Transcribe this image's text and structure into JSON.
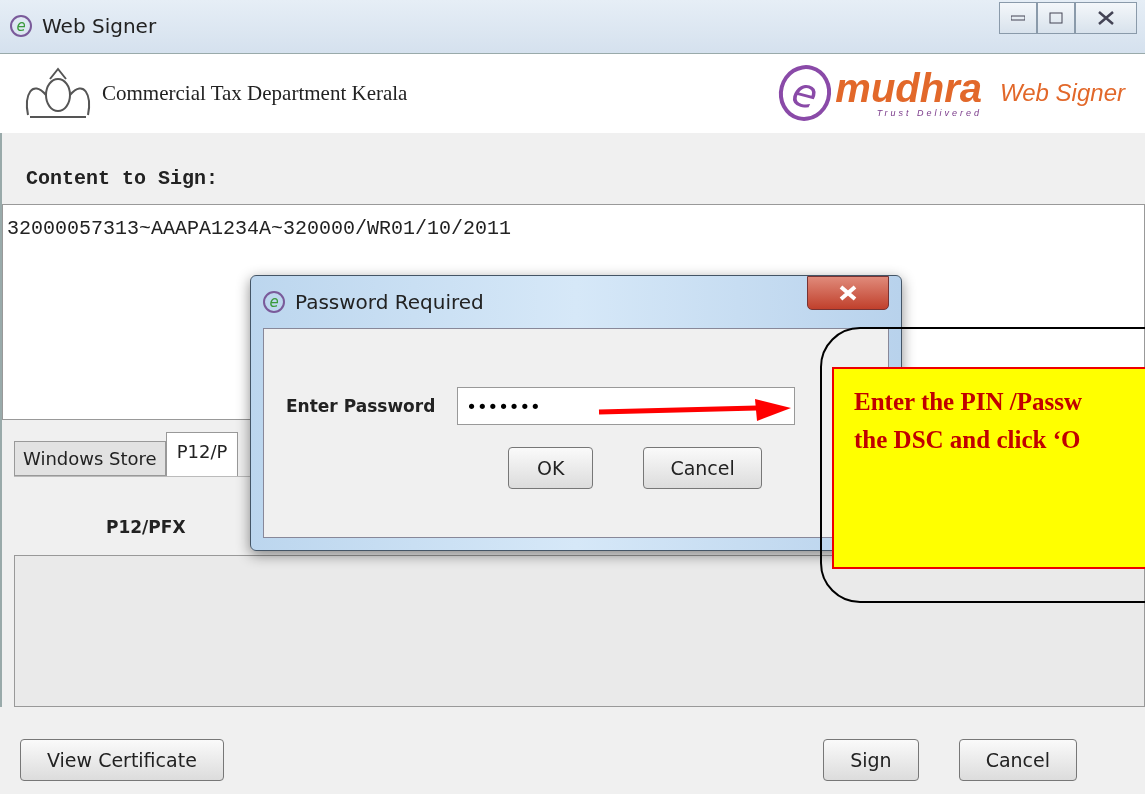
{
  "window": {
    "icon": "e",
    "title": "Web Signer"
  },
  "header": {
    "logo_letter": "e",
    "department": "Commercial Tax Department Kerala",
    "logo_text": "mudhra",
    "logo_tagline": "Trust Delivered",
    "product": "Web Signer"
  },
  "content": {
    "label": "Content to Sign:",
    "value": "32000057313~AAAPA1234A~320000/WR01/10/2011"
  },
  "tabs": [
    {
      "label": "Windows Store",
      "selected": false
    },
    {
      "label": "P12/P",
      "selected": true
    }
  ],
  "panel": {
    "label": "P12/PFX"
  },
  "buttons": [
    {
      "label": "View Certificate"
    },
    {
      "label": "Sign"
    },
    {
      "label": "Cancel"
    }
  ],
  "dialog": {
    "icon": "e",
    "title": "Password Required",
    "field_label": "Enter Password",
    "value": "•••••••",
    "buttons": [
      {
        "label": "OK"
      },
      {
        "label": "Cancel"
      }
    ]
  },
  "callout": {
    "lines": [
      "Enter the PIN /Passw",
      "the DSC and click ‘O"
    ]
  }
}
